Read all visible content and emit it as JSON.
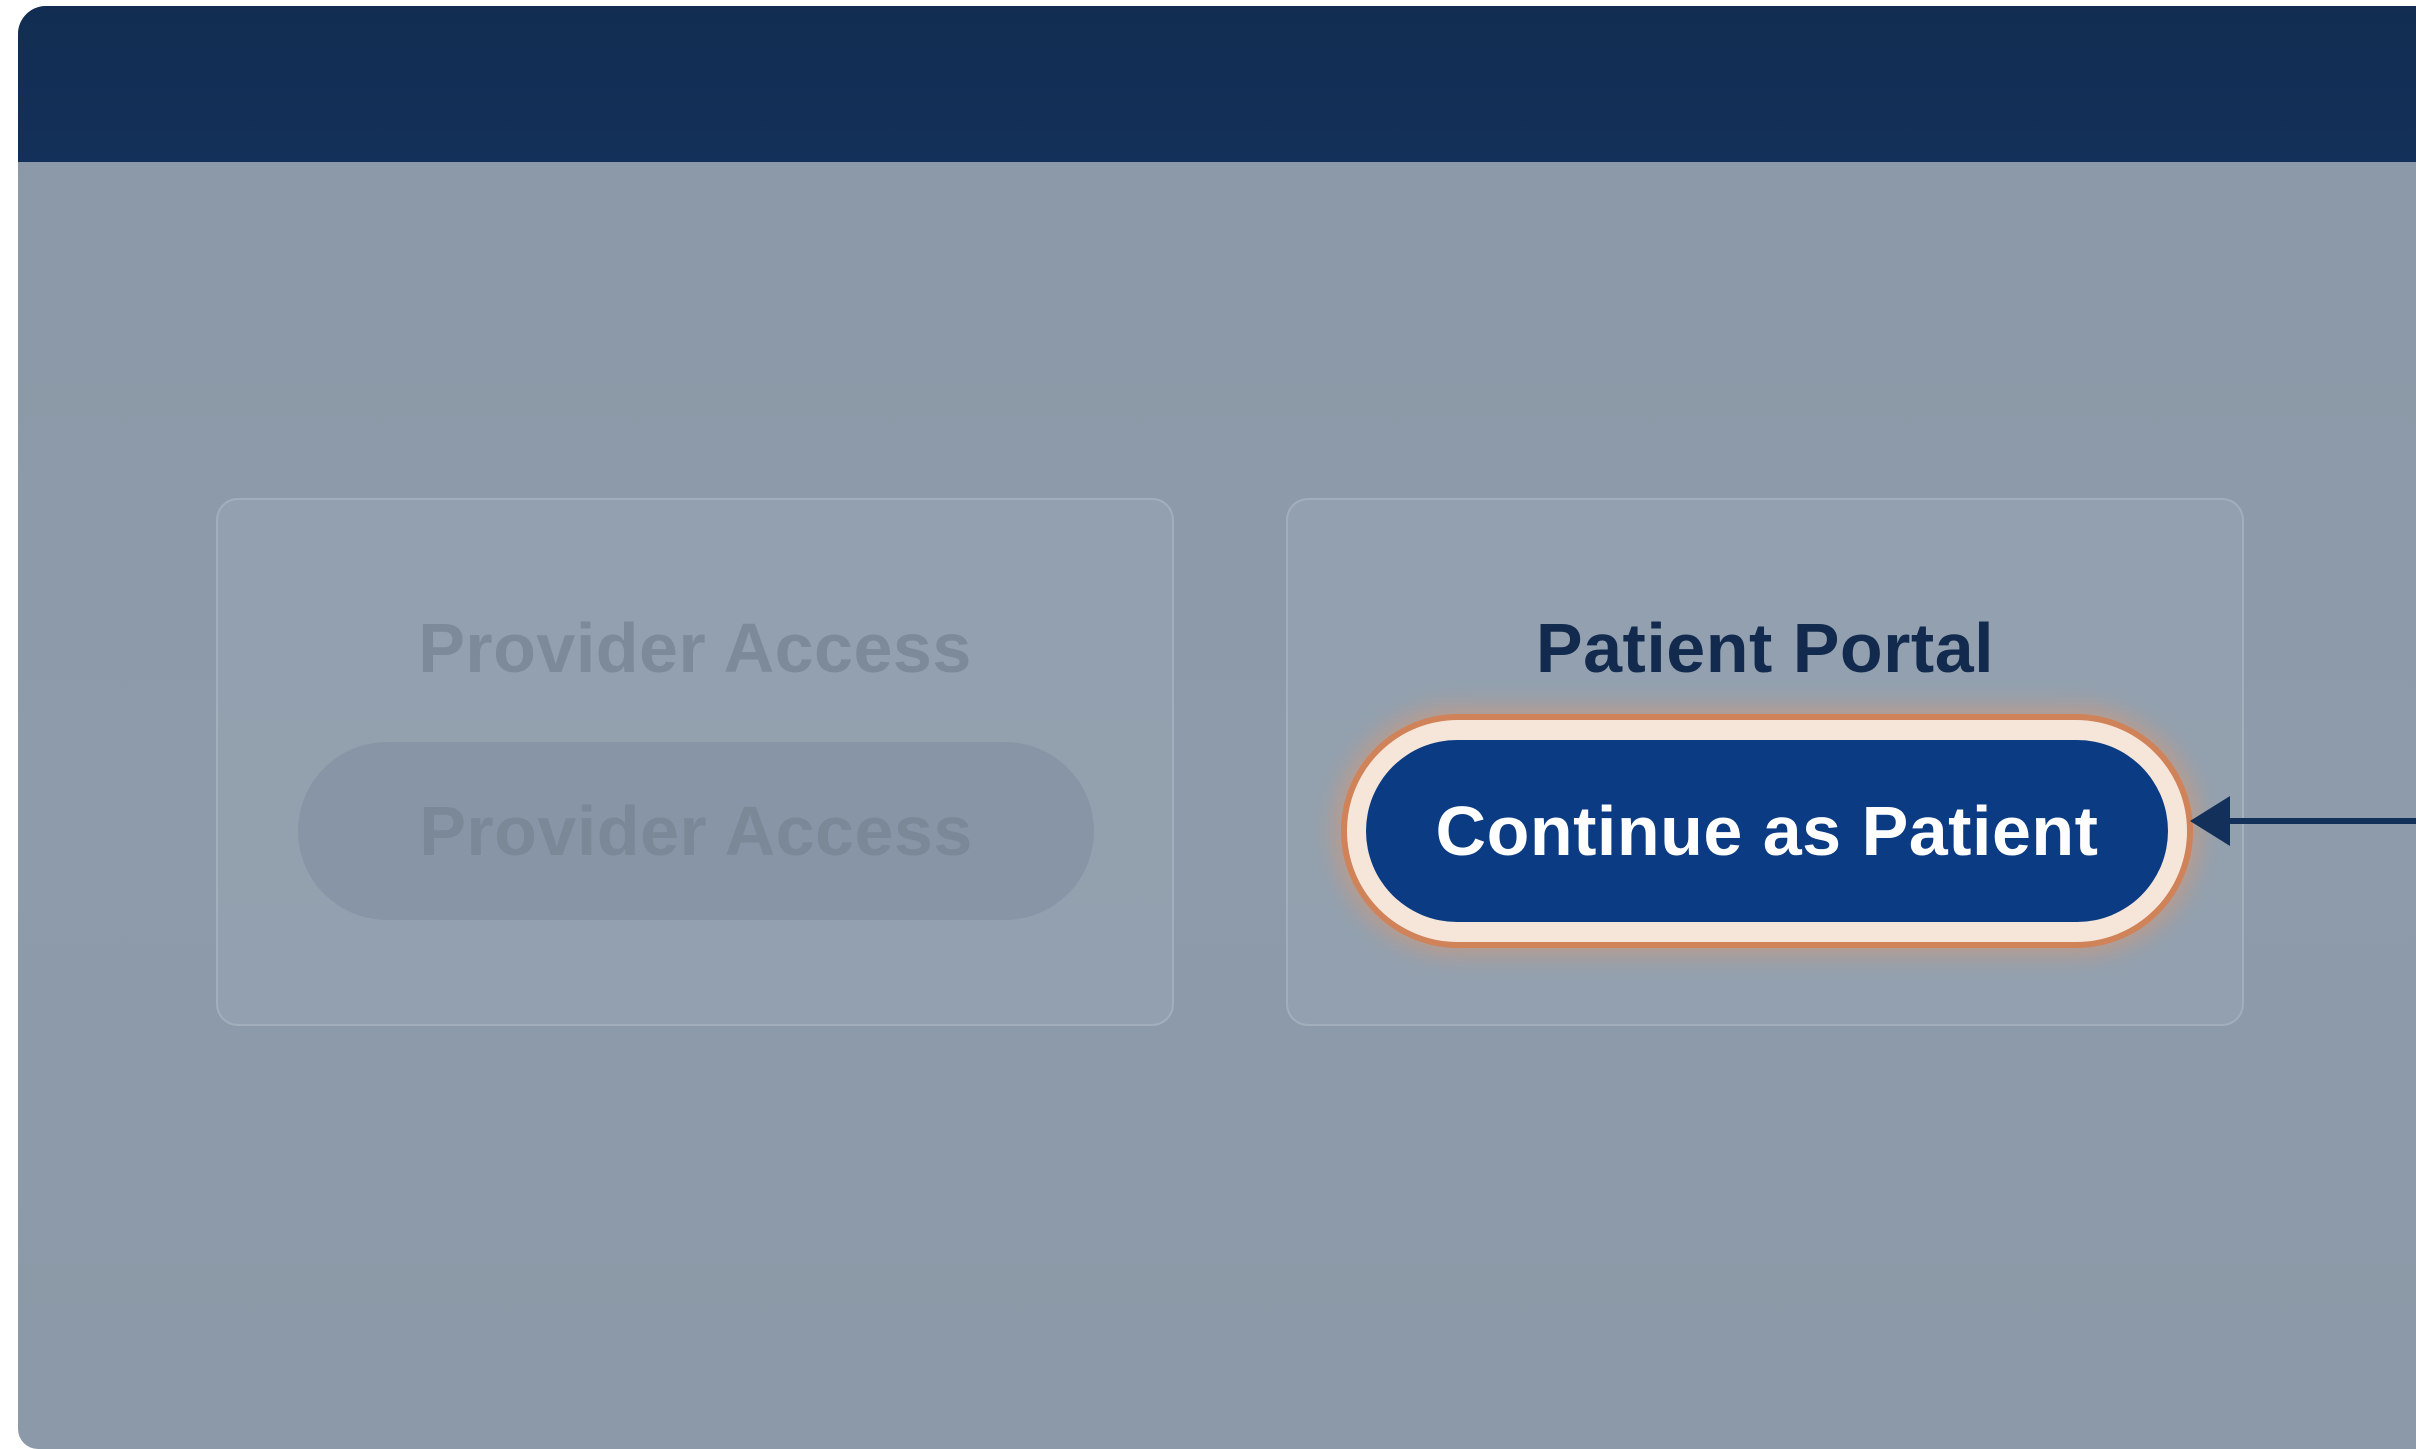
{
  "provider_card": {
    "title": "Provider Access",
    "button_label": "Provider Access"
  },
  "patient_card": {
    "title": "Patient Portal",
    "button_label": "Continue as Patient"
  },
  "pointer": {
    "icon": "arrow-left-icon"
  },
  "colors": {
    "header": "#13305a",
    "primary_button": "#0b3b82",
    "highlight_ring": "#d08258",
    "overlay": "#8c9aa9"
  }
}
